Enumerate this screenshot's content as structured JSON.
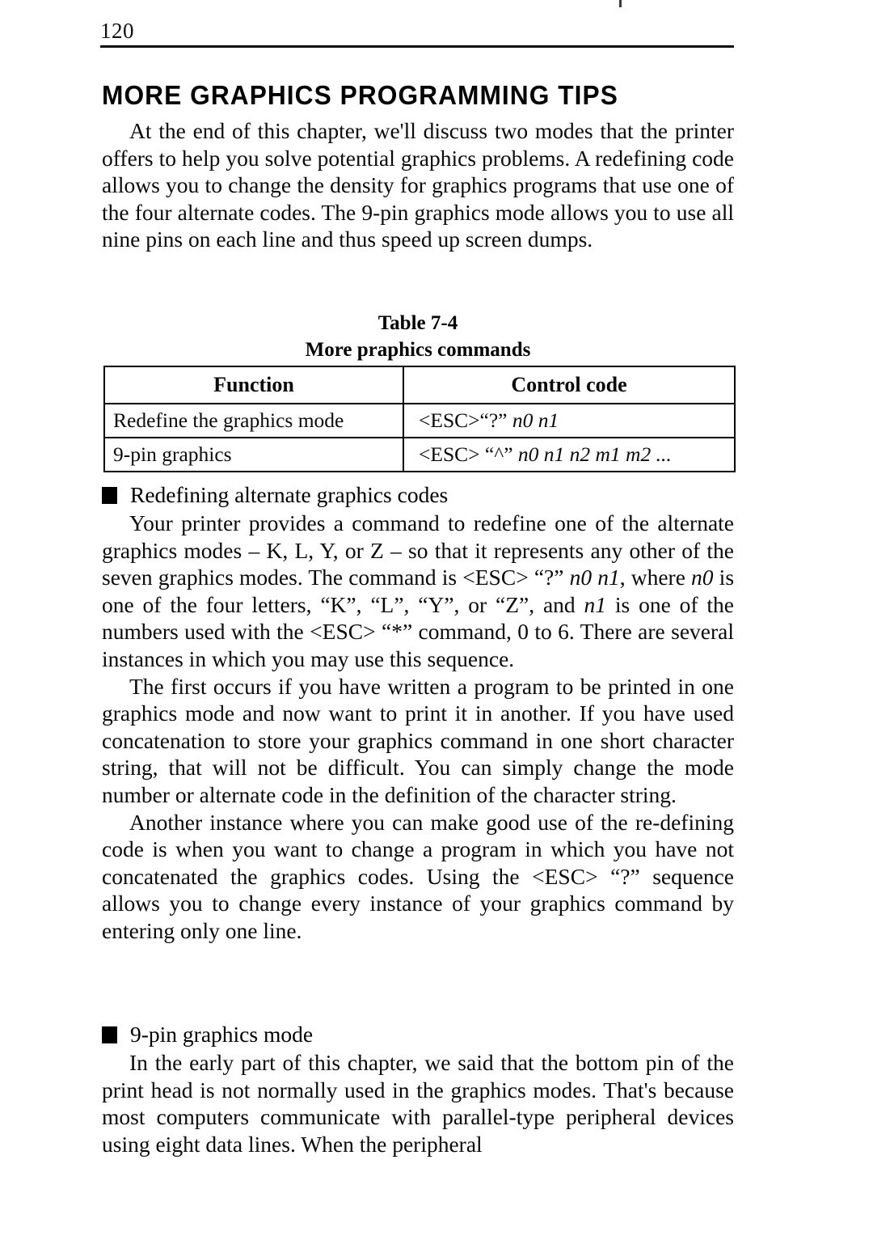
{
  "page": {
    "folio": "120",
    "title": "MORE GRAPHICS PROGRAMMING TIPS"
  },
  "intro_paragraph": "At the end of this chapter, we'll discuss two modes that the printer offers to help you solve potential graphics problems. A redefining code allows you to change the density for graphics programs that use one of the four alternate codes. The 9-pin graphics mode allows you to use all nine pins on each line and thus speed up screen dumps.",
  "table": {
    "number": "Table 7-4",
    "caption": "More praphics commands",
    "headers": [
      "Function",
      "Control code"
    ],
    "rows": [
      {
        "function": "Redefine the graphics mode",
        "code_prefix": "<ESC>“?”",
        "code_params": "n0 n1"
      },
      {
        "function": "9-pin graphics",
        "code_prefix": "<ESC> “^”",
        "code_params": "n0 n1 n2 m1 m2 ..."
      }
    ]
  },
  "sections": [
    {
      "heading": "Redefining alternate graphics codes",
      "paragraph_1_a": "Your printer provides a command to redefine one of the alternate graphics modes – K, L, Y, or Z – so that it represents any other of the seven graphics modes. The command is ",
      "esc_1": "<ESC> “?”",
      "param_1": "n0 n1",
      "paragraph_1_b": ", where ",
      "param_2": "n0",
      "paragraph_1_c": " is one of the four letters, “K”, “L”, “Y”, or “Z”, and ",
      "param_3": "n1",
      "paragraph_1_d": " is one of the numbers used with the ",
      "esc_2": "<ESC> “*”",
      "paragraph_1_e": " command, 0 to 6. There are several instances in which you may use this sequence.",
      "paragraph_2": "The first occurs if you have written a program to be printed in one graphics mode and now want to print it in another. If you have used concatenation to store your graphics command in one short character string, that will not be difficult. You can simply change the mode number or alternate code in the definition of the character string.",
      "paragraph_3_a": "Another instance where you can make good use of the re-defining code is when you want to change a program in which you have not concatenated the graphics codes. Using the ",
      "esc_3": "<ESC> “?”",
      "paragraph_3_b": " sequence allows you to change every instance of your graphics command by entering only one line."
    },
    {
      "heading": "9-pin graphics mode",
      "paragraph_1": "In the early part of this chapter, we said that the bottom pin of the print head is not normally used in the graphics modes. That's because most computers communicate with parallel-type peripheral devices using eight data lines. When the peripheral"
    }
  ]
}
